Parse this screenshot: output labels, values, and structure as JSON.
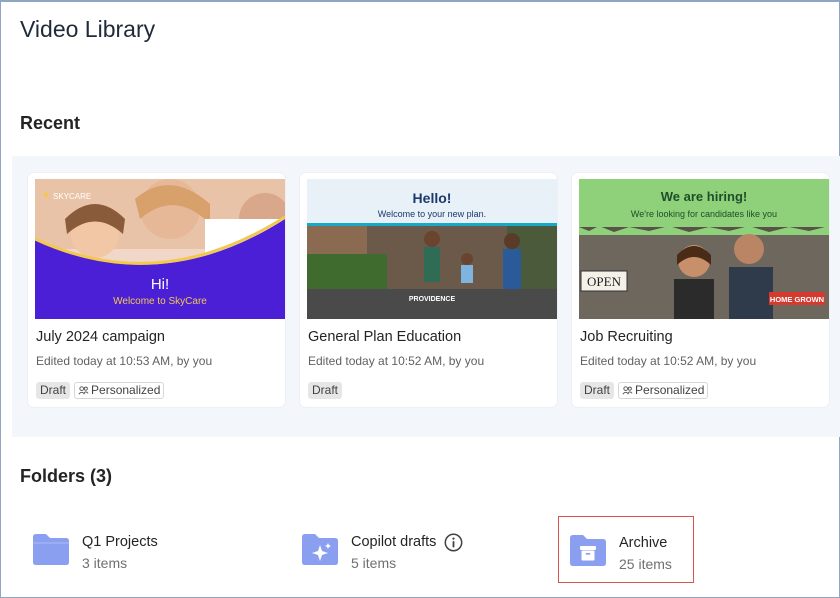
{
  "page": {
    "title": "Video Library"
  },
  "recent": {
    "title": "Recent",
    "cards": [
      {
        "title": "July 2024 campaign",
        "meta": "Edited today at 10:53 AM, by you",
        "tags": [
          "Draft",
          "Personalized"
        ],
        "thumb": {
          "brand": "SKYCARE",
          "headline": "Hi!",
          "subline": "Welcome to SkyCare"
        }
      },
      {
        "title": "General Plan Education",
        "meta": "Edited today at 10:52 AM, by you",
        "tags": [
          "Draft"
        ],
        "thumb": {
          "headline": "Hello!",
          "subline": "Welcome to your new plan.",
          "brand": "PROVIDENCE"
        }
      },
      {
        "title": "Job Recruiting",
        "meta": "Edited today at 10:52 AM, by you",
        "tags": [
          "Draft",
          "Personalized"
        ],
        "thumb": {
          "headline": "We are hiring!",
          "subline": "We're looking for candidates like you",
          "sign": "OPEN",
          "brand": "HOME GROWN"
        }
      }
    ]
  },
  "folders": {
    "title": "Folders (3)",
    "items": [
      {
        "name": "Q1 Projects",
        "count": "3 items",
        "icon": "folder-icon"
      },
      {
        "name": "Copilot drafts",
        "count": "5 items",
        "icon": "sparkle-folder-icon"
      },
      {
        "name": "Archive",
        "count": "25 items",
        "icon": "archive-folder-icon"
      }
    ]
  },
  "colors": {
    "folder": "#8b9ff0",
    "band": "#f3f6fb",
    "highlight": "#d9534f",
    "skycare_purple": "#4b1fd6",
    "hiring_green": "#8fd07a",
    "hello_teal": "#17a9c7"
  }
}
